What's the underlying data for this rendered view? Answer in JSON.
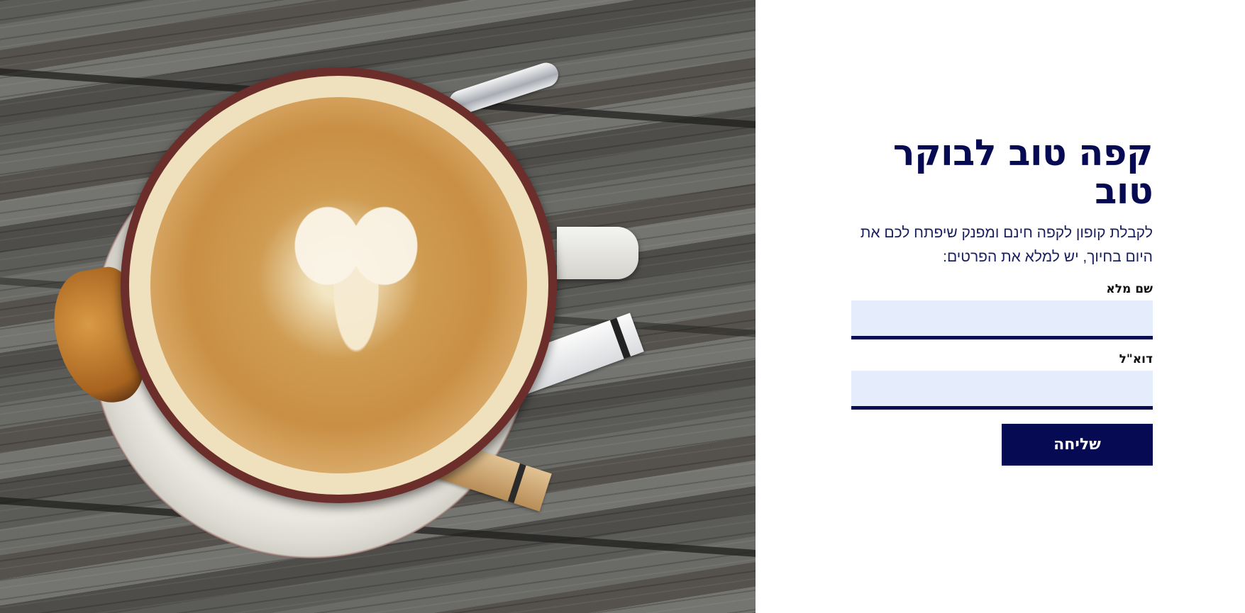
{
  "hero_image": {
    "subject": "latte art coffee cup on wooden table",
    "icon": "coffee-photo"
  },
  "form": {
    "title": "קפה טוב לבוקר טוב",
    "intro": "לקבלת קופון לקפה חינם ומפנק שיפתח לכם את היום בחיוך, יש למלא את הפרטים:",
    "name_label": "שם מלא",
    "name_value": "",
    "email_label": "דוא\"ל",
    "email_value": "",
    "submit_label": "שליחה"
  },
  "colors": {
    "brand": "#050a52",
    "input_bg": "#e5edfc",
    "background": "#ffffff"
  }
}
